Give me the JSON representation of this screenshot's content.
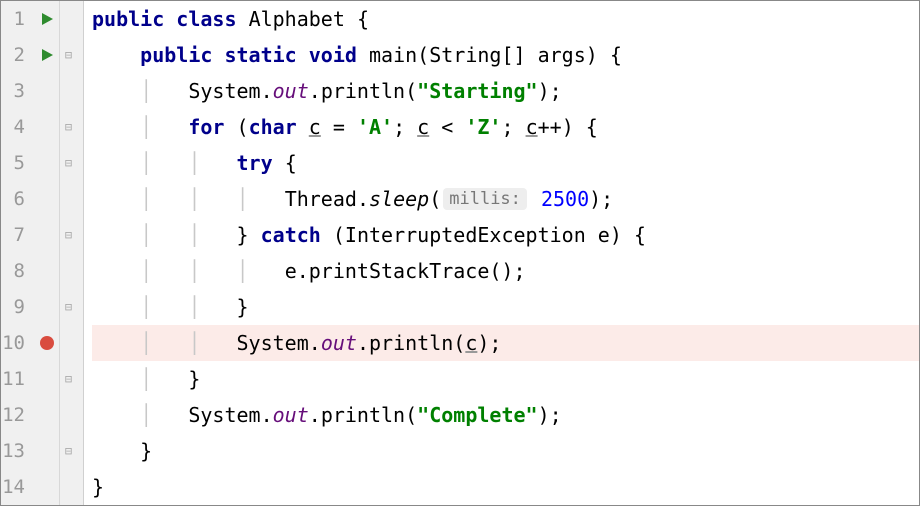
{
  "lines": {
    "l1": "1",
    "l2": "2",
    "l3": "3",
    "l4": "4",
    "l5": "5",
    "l6": "6",
    "l7": "7",
    "l8": "8",
    "l9": "9",
    "l10": "10",
    "l11": "11",
    "l12": "12",
    "l13": "13",
    "l14": "14"
  },
  "code": {
    "public": "public",
    "class": "class",
    "className": "Alphabet",
    "static": "static",
    "void": "void",
    "main": "main",
    "stringArr": "String[] args",
    "system": "System",
    "out": "out",
    "println": "println",
    "starting": "\"Starting\"",
    "for": "for",
    "char": "char",
    "c": "c",
    "eq": " = ",
    "charA": "'A'",
    "lt": " < ",
    "charZ": "'Z'",
    "inc": "++",
    "try": "try",
    "thread": "Thread",
    "sleep": "sleep",
    "millisHint": "millis:",
    "millisVal": "2500",
    "catch": "catch",
    "excType": "InterruptedException e",
    "printStack": "e.printStackTrace()",
    "complete": "\"Complete\"",
    "openBrace": "{",
    "closeBrace": "}",
    "openParen": "(",
    "closeParen": ")",
    "semi": ";",
    "dot": "."
  }
}
